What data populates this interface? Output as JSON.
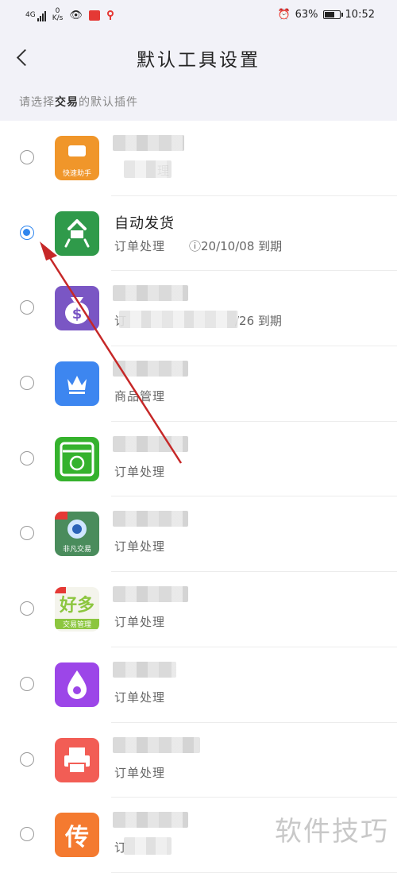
{
  "status_bar": {
    "network": "4G",
    "speed_value": "0",
    "speed_unit": "K/s",
    "battery": "63%",
    "battery_level": 0.63,
    "time": "10:52"
  },
  "header": {
    "title": "默认工具设置"
  },
  "subtitle": {
    "prefix": "请选择",
    "emphasis": "交易",
    "suffix": "的默认插件"
  },
  "apps": [
    {
      "name": "",
      "sub": "理",
      "icon": "trade-assistant-icon",
      "icon_label": "快速助手",
      "color": "#f0962a",
      "selected": false
    },
    {
      "name": "自动发货",
      "sub": "订单处理",
      "expiry": "ⓘ20/10/08 到期",
      "icon": "auto-ship-icon",
      "color": "#2f9a4a",
      "selected": true
    },
    {
      "name": "",
      "sub": "订",
      "expiry": "/26 到期",
      "icon": "money-bag-icon",
      "color": "#7a56c4",
      "selected": false
    },
    {
      "name": "",
      "sub": "商品管理",
      "icon": "crown-icon",
      "color": "#3d86f0",
      "selected": false
    },
    {
      "name": "",
      "sub": "订单处理",
      "icon": "shop-icon",
      "color": "#35b22d",
      "selected": false
    },
    {
      "name": "",
      "sub": "订单处理",
      "icon": "feifan-icon",
      "icon_label": "非凡交易",
      "color": "#4a8c5c",
      "selected": false
    },
    {
      "name": "",
      "sub": "订单处理",
      "icon": "haoduo-icon",
      "icon_label": "交易管理",
      "color": "#f4f4ec",
      "selected": false
    },
    {
      "name": "",
      "sub": "订单处理",
      "icon": "droplet-icon",
      "color": "#9c46e8",
      "selected": false
    },
    {
      "name": "",
      "sub": "订单处理",
      "icon": "printer-icon",
      "color": "#f25d55",
      "selected": false
    },
    {
      "name": "",
      "sub": "订",
      "icon": "chuan-icon",
      "icon_glyph": "传",
      "color": "#f47a30",
      "selected": false
    }
  ],
  "watermark": "软件技巧"
}
